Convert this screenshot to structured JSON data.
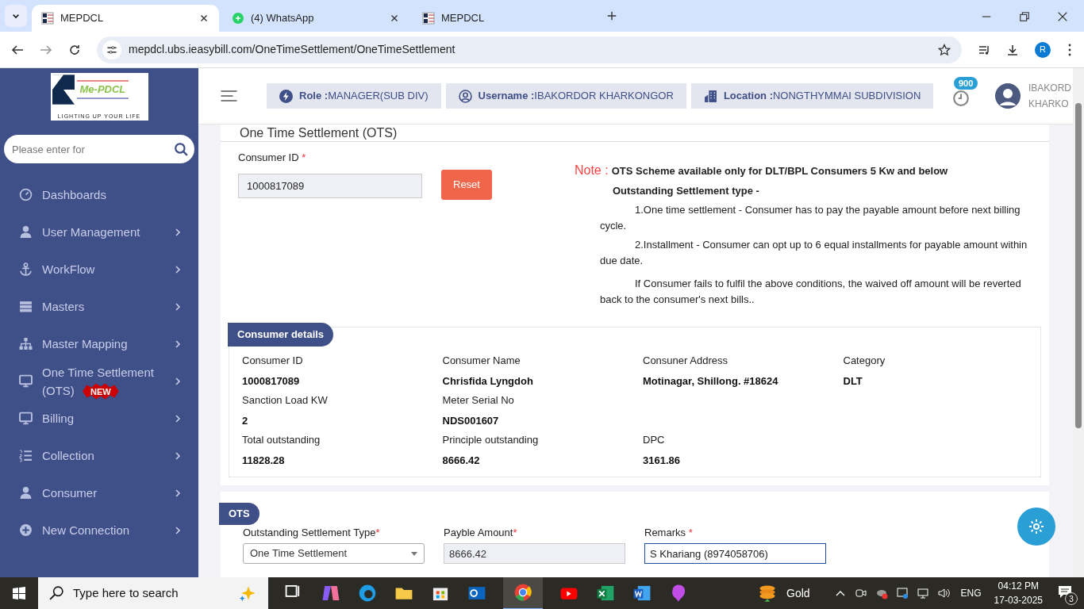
{
  "browser": {
    "tabs": [
      {
        "title": "MEPDCL",
        "kind": "site",
        "selected": true
      },
      {
        "title": "(4) WhatsApp",
        "kind": "chat",
        "selected": false
      },
      {
        "title": "MEPDCL",
        "kind": "site",
        "selected": false
      }
    ],
    "url": "mepdcl.ubs.ieasybill.com/OneTimeSettlement/OneTimeSettlement",
    "profile_initial": "R"
  },
  "sidebar": {
    "logo": {
      "name": "Me-PDCL",
      "tagline": "LIGHTING UP YOUR LIFE"
    },
    "search": {
      "placeholder": "Please enter for"
    },
    "items": [
      {
        "label": "Dashboards",
        "kind": "link"
      },
      {
        "label": "User Management",
        "kind": "menu"
      },
      {
        "label": "WorkFlow",
        "kind": "menu"
      },
      {
        "label": "Masters",
        "kind": "menu"
      },
      {
        "label": "Master Mapping",
        "kind": "menu"
      },
      {
        "label": "One Time Settlement (OTS)",
        "kind": "menu",
        "badge": "NEW"
      },
      {
        "label": "Billing",
        "kind": "menu"
      },
      {
        "label": "Collection",
        "kind": "menu"
      },
      {
        "label": "Consumer",
        "kind": "menu"
      },
      {
        "label": "New Connection",
        "kind": "menu"
      }
    ]
  },
  "header": {
    "chips": [
      {
        "label": "Role :",
        "value": "MANAGER(SUB DIV)"
      },
      {
        "label": "Username :",
        "value": "IBAKORDOR KHARKONGOR"
      },
      {
        "label": "Location :",
        "value": "NONGTHYMMAI SUBDIVISION"
      }
    ],
    "notifications": "900",
    "user_lines": [
      "IBAKORD",
      "KHARKO"
    ]
  },
  "page_title": "One Time Settlement (OTS)",
  "consumer_id": {
    "label": "Consumer ID",
    "required_mark": "*",
    "value": "1000817089"
  },
  "reset_button": "Reset",
  "note": {
    "label": "Note :",
    "heading": "OTS Scheme available only for DLT/BPL Consumers 5 Kw and below",
    "subheading": "Outstanding Settlement type -",
    "paragraphs": [
      "1.One time settlement - Consumer has to pay the payable amount before next billing cycle.",
      "2.Installment - Consumer can opt up to 6 equal installments for payable amount within due date.",
      "If Consumer fails to fulfil the above conditions, the waived off amount will be reverted back to the consumer's next bills.."
    ]
  },
  "consumer_details": {
    "title": "Consumer details",
    "rows": [
      [
        {
          "label": "Consumer ID",
          "value": "1000817089"
        },
        {
          "label": "Consumer Name",
          "value": "Chrisfida Lyngdoh"
        },
        {
          "label": "Consuner Address",
          "value": "Motinagar, Shillong. #18624"
        },
        {
          "label": "Category",
          "value": "DLT"
        }
      ],
      [
        {
          "label": "Sanction Load KW",
          "value": "2"
        },
        {
          "label": "Meter Serial No",
          "value": "NDS001607"
        }
      ],
      [
        {
          "label": "Total outstanding",
          "value": "11828.28"
        },
        {
          "label": "Principle outstanding",
          "value": "8666.42"
        },
        {
          "label": "DPC",
          "value": "3161.86"
        }
      ]
    ]
  },
  "ots": {
    "title": "OTS",
    "fields": [
      {
        "label": "Outstanding Settlement Type",
        "required_mark": "*",
        "kind": "select",
        "value": "One Time Settlement"
      },
      {
        "label": "Payble Amount",
        "required_mark": "*",
        "kind": "readonly",
        "value": "8666.42"
      },
      {
        "label": "Remarks",
        "required_mark": "*",
        "kind": "input",
        "value": "S Khariang (8974058706)"
      }
    ]
  },
  "taskbar": {
    "search_placeholder": "Type here to search",
    "weather": "Gold",
    "language": "ENG",
    "time": "04:12 PM",
    "date": "17-03-2025",
    "notifications": "3"
  }
}
